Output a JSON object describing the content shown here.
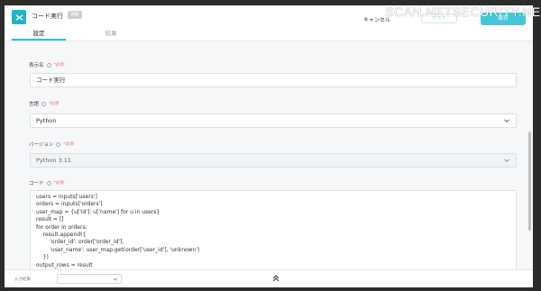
{
  "header": {
    "app_icon": "code-scissors-icon",
    "title": "コード実行",
    "badge": "β版",
    "cancel_label": "キャンセル",
    "test_label": "テスト",
    "save_label": "保存"
  },
  "watermark": "SCAN.NETSECURITY.NE.JP",
  "tabs": [
    {
      "label": "設定",
      "active": true
    },
    {
      "label": "結果",
      "active": false
    }
  ],
  "form": {
    "display_name": {
      "label": "表示名",
      "required": "*必須",
      "value": "コード実行"
    },
    "language": {
      "label": "言語",
      "required": "*必須",
      "value": "Python"
    },
    "version": {
      "label": "バージョン",
      "required": "*必須",
      "value": "Python 3.11"
    },
    "code": {
      "label": "コード",
      "required": "*必須",
      "lines": [
        "users = inputs['users']",
        "orders = inputs['orders']",
        "user_map = {u['id']: u['name'] for u in users}",
        "result = []",
        "for order in orders:",
        "    result.append({",
        "        'order_id': order['order_id'],",
        "        'user_name': user_map.get(order['user_id'], 'unknown')",
        "    })",
        "output_rows = result"
      ]
    }
  },
  "footer": {
    "label": "入力結果",
    "select_value": ""
  },
  "colors": {
    "accent": "#2fbdd0",
    "required": "#e26d6d"
  }
}
